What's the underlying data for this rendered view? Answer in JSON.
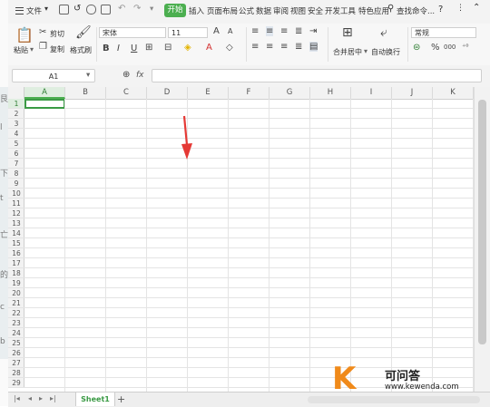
{
  "colors": {
    "accent": "#4caf50",
    "arrow": "#e53935",
    "watermark_k": "#f08a1a"
  },
  "menubar": {
    "file_label": "文件",
    "tabs": [
      {
        "label": "开始"
      },
      {
        "label": "插入"
      },
      {
        "label": "页面布局"
      },
      {
        "label": "公式"
      },
      {
        "label": "数据"
      },
      {
        "label": "审阅"
      },
      {
        "label": "视图"
      },
      {
        "label": "安全"
      },
      {
        "label": "开发工具"
      },
      {
        "label": "特色应用"
      }
    ],
    "search_label": "查找命令...",
    "help_icon": "?"
  },
  "ribbon": {
    "paste_label": "粘贴",
    "cut_label": "剪切",
    "copy_label": "复制",
    "format_painter_label": "格式刷",
    "font_name": "宋体",
    "font_size": "11",
    "bold": "B",
    "italic": "I",
    "underline": "U",
    "merge_center_label": "合并居中",
    "wrap_text_label": "自动换行",
    "number_format": "常规",
    "percent": "%",
    "thousands": "000"
  },
  "formula_bar": {
    "name_box": "A1",
    "fx_label": "fx",
    "formula_value": ""
  },
  "grid": {
    "columns": [
      "A",
      "B",
      "C",
      "D",
      "E",
      "F",
      "G",
      "H",
      "I",
      "J",
      "K"
    ],
    "rows": [
      "1",
      "2",
      "3",
      "4",
      "5",
      "6",
      "7",
      "8",
      "9",
      "10",
      "11",
      "12",
      "13",
      "14",
      "15",
      "16",
      "17",
      "18",
      "19",
      "20",
      "21",
      "22",
      "23",
      "24",
      "25",
      "26",
      "27",
      "28",
      "29"
    ],
    "active_cell": "A1"
  },
  "sheets": {
    "tabs": [
      {
        "label": "Sheet1"
      }
    ],
    "add_label": "+"
  },
  "watermark": {
    "letter": "K",
    "title": "可问答",
    "url": "www.kewenda.com"
  },
  "background_window": {
    "chars": [
      "艮",
      "l",
      "下",
      "t",
      "亡",
      "的",
      "c",
      "b"
    ]
  }
}
